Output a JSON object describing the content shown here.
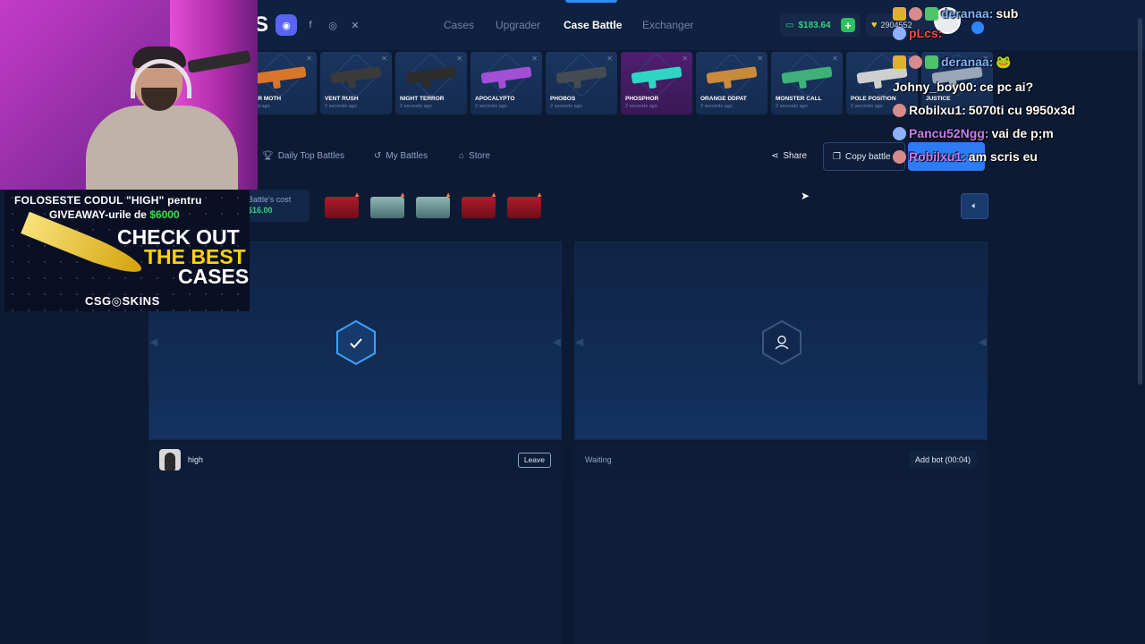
{
  "header": {
    "logo_letter": "S",
    "nav": [
      "Cases",
      "Upgrader",
      "Case Battle",
      "Exchanger"
    ],
    "active_nav": "Case Battle",
    "balance": "$183.64",
    "balance_plus": "+",
    "coins": "2904552"
  },
  "drops": [
    {
      "name": "GER MOTH",
      "time": "cond ago",
      "color": "#d9762a",
      "pink": false
    },
    {
      "name": "VENT RUSH",
      "time": "2 seconds ago",
      "color": "#3a3a3a",
      "pink": false
    },
    {
      "name": "NIGHT TERROR",
      "time": "2 seconds ago",
      "color": "#2c2c2c",
      "pink": false
    },
    {
      "name": "APOCALYPTO",
      "time": "2 seconds ago",
      "color": "#a24fd6",
      "pink": false
    },
    {
      "name": "PHOBOS",
      "time": "2 seconds ago",
      "color": "#454b52",
      "pink": false
    },
    {
      "name": "PHOSPHOR",
      "time": "2 seconds ago",
      "color": "#2fd6c4",
      "pink": true
    },
    {
      "name": "ORANGE DDPAT",
      "time": "2 seconds ago",
      "color": "#c98a3a",
      "pink": false
    },
    {
      "name": "MONSTER CALL",
      "time": "2 seconds ago",
      "color": "#3fb07a",
      "pink": false
    },
    {
      "name": "POLE POSITION",
      "time": "2 seconds ago",
      "color": "#cfcfcf",
      "pink": false
    },
    {
      "name": "JUSTICE",
      "time": "",
      "color": "#9aa7b8",
      "pink": false
    }
  ],
  "toolbar": {
    "daily_top": "Daily Top Battles",
    "my_battles": "My Battles",
    "store": "Store",
    "share": "Share",
    "copy_battle": "Copy battle"
  },
  "battle": {
    "cost_label": "Battle's cost",
    "cost_value": "$16.00",
    "cases": [
      "red",
      "teal",
      "teal",
      "red",
      "red"
    ],
    "player1_name": "high",
    "leave_label": "Leave",
    "waiting_label": "Waiting",
    "add_bot_label": "Add bot (00:04)"
  },
  "promo": {
    "line1": "FOLOSESTE CODUL \"HIGH\" pentru",
    "line2_prefix": "GIVEAWAY-urile de ",
    "line2_amount": "$6000",
    "co1": "CHECK OUT",
    "co2": "THE BEST",
    "co3": "CASES",
    "brand": "CSG◎SKINS"
  },
  "chat": [
    {
      "name": "deranaa:",
      "msg": "sub",
      "color": "#7fb4ff",
      "badges": [
        "crown",
        "user",
        "bot"
      ]
    },
    {
      "name": "pLcs:",
      "msg": "",
      "color": "#ff4a4a",
      "badges": [
        "blue"
      ]
    },
    {
      "name": "deranaa:",
      "msg": "🐸",
      "color": "#7fb4ff",
      "badges": [
        "crown",
        "user",
        "bot"
      ]
    },
    {
      "name": "Johny_boy00:",
      "msg": "ce pc ai?",
      "color": "#ffffff",
      "badges": []
    },
    {
      "name": "Robilxu1:",
      "msg": "5070ti cu 9950x3d",
      "color": "#ffffff",
      "badges": [
        "user"
      ]
    },
    {
      "name": "Pancu52Ngg:",
      "msg": "vai de p;m",
      "color": "#c77dff",
      "badges": [
        "blue"
      ]
    },
    {
      "name": "Robilxu1:",
      "msg": "am scris eu",
      "color": "#c77dff",
      "badges": [
        "user"
      ]
    }
  ]
}
